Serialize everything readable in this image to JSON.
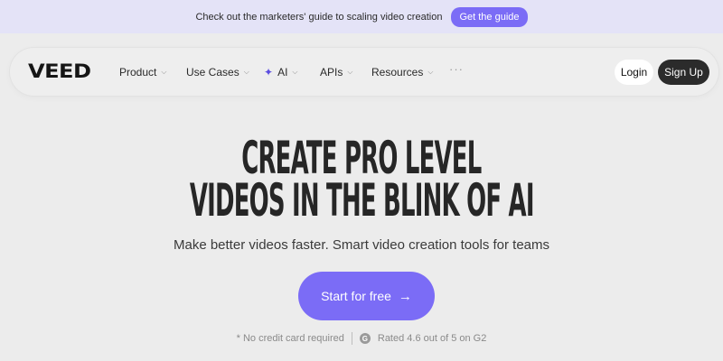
{
  "banner": {
    "text": "Check out the marketers' guide to scaling video creation",
    "button_label": "Get the guide"
  },
  "nav": {
    "logo": "VEED",
    "items": [
      {
        "label": "Product",
        "icon": "chevron-down-icon"
      },
      {
        "label": "Use Cases",
        "icon": "chevron-down-icon"
      },
      {
        "label": "AI",
        "icon": "chevron-down-icon",
        "prefix_icon": "sparkle-icon"
      },
      {
        "label": "APIs",
        "icon": "chevron-down-icon"
      },
      {
        "label": "Resources",
        "icon": "chevron-down-icon"
      }
    ],
    "more_label": "···",
    "login_label": "Login",
    "signup_label": "Sign Up"
  },
  "hero": {
    "headline_line1": "CREATE PRO LEVEL",
    "headline_line2": "VIDEOS IN THE BLINK OF AI",
    "subtitle": "Make better videos faster. Smart video creation tools for teams",
    "cta_label": "Start for free",
    "cta_arrow": "→",
    "footnote_left": "* No credit card required",
    "footnote_right": "Rated 4.6 out of 5 on G2",
    "g2_glyph": "G"
  },
  "colors": {
    "accent": "#7b6cf6",
    "banner_bg": "#e4e3f7",
    "page_bg": "#ececec",
    "dark_button": "#2b2b2b"
  }
}
